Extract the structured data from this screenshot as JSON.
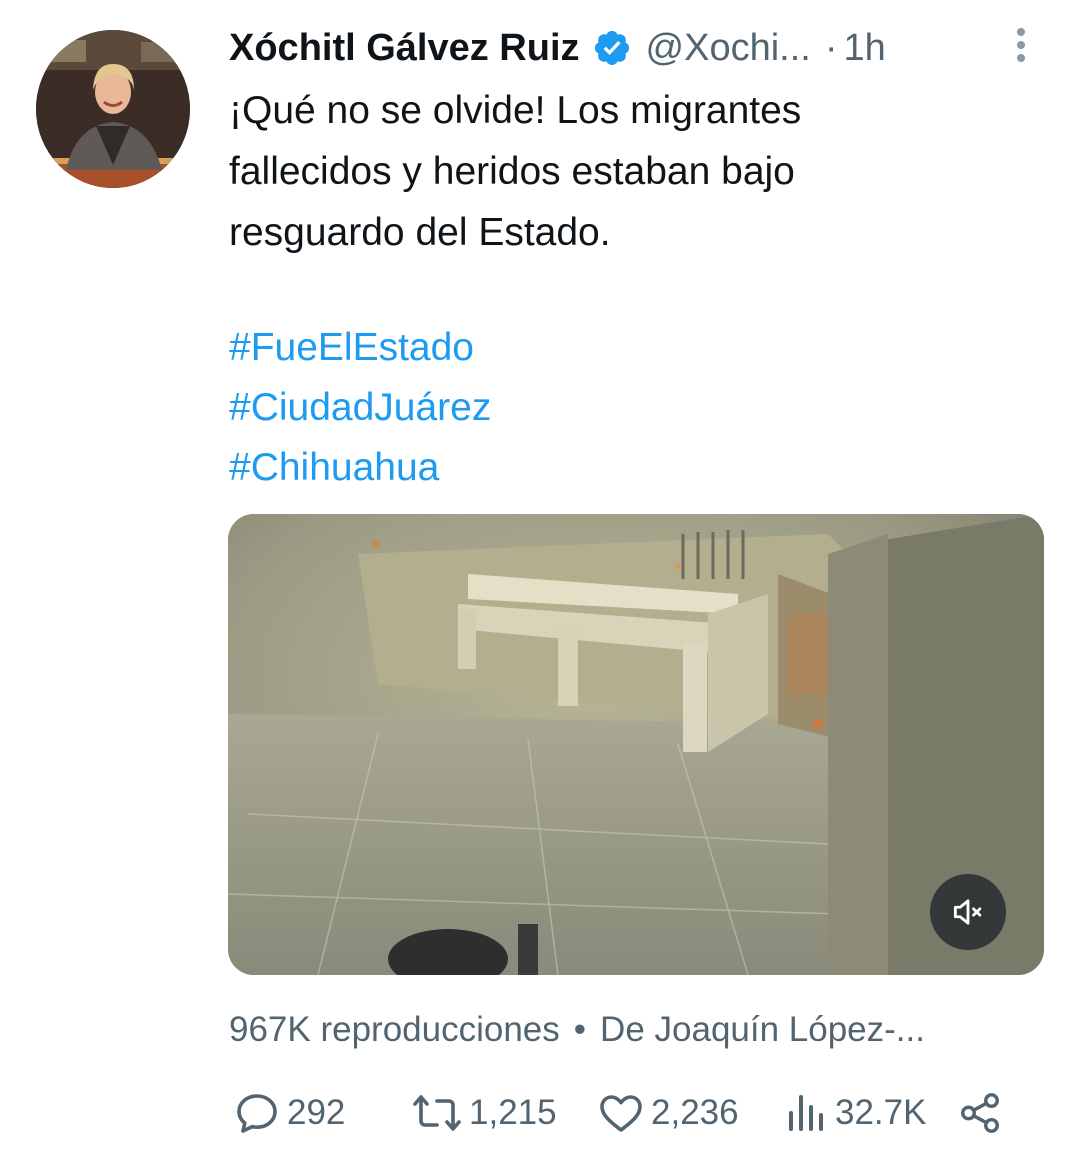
{
  "author": {
    "display_name": "Xóchitl Gálvez Ruiz",
    "handle": "@Xochi...",
    "separator": "·",
    "time": "1h",
    "verified_color": "#1d9bf0"
  },
  "tweet": {
    "text": "¡Qué no se olvide! Los migrantes\nfallecidos y heridos estaban bajo\nresguardo del Estado.",
    "hashtags": [
      "#FueElEstado",
      "#CiudadJuárez",
      "#Chihuahua"
    ],
    "link_color": "#1d9bf0"
  },
  "media": {
    "type": "video",
    "mute_icon": "speaker-muted-icon"
  },
  "meta": {
    "views": "967K reproducciones",
    "separator": "•",
    "source": "De Joaquín López-..."
  },
  "actions": {
    "replies": "292",
    "retweets": "1,215",
    "likes": "2,236",
    "views": "32.7K",
    "icons": [
      "reply-icon",
      "retweet-icon",
      "like-icon",
      "views-icon",
      "share-icon"
    ]
  }
}
